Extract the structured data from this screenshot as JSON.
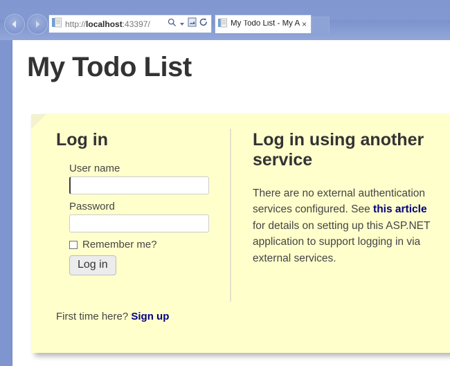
{
  "browser": {
    "back_button": "Back",
    "forward_button": "Forward",
    "address": {
      "scheme": "http://",
      "host": "localhost",
      "rest": ":43397/"
    },
    "icons": {
      "favicon": "page-icon",
      "search": "search-icon",
      "dropdown": "chevron-down-icon",
      "compatibility": "compatibility-view-icon",
      "refresh": "refresh-icon"
    },
    "tab": {
      "title": "My Todo List - My A...",
      "close_label": "×",
      "favicon": "page-icon"
    }
  },
  "page": {
    "title": "My Todo List",
    "login": {
      "heading": "Log in",
      "username_label": "User name",
      "username_value": "",
      "username_placeholder": "",
      "password_label": "Password",
      "password_value": "",
      "password_placeholder": "",
      "remember_label": "Remember me?",
      "submit_label": "Log in"
    },
    "signup": {
      "prompt": "First time here?",
      "link_label": "Sign up"
    },
    "external": {
      "heading": "Log in using another service",
      "body_before": "There are no external authentication services configured. See ",
      "link_label": "this article",
      "body_after": " for details on setting up this ASP.NET application to support logging in via external services."
    }
  },
  "colors": {
    "chrome": "#8398d1",
    "note_background": "#ffffcc",
    "note_fold": "#f2f2cf",
    "link": "#000080",
    "heading": "#333333",
    "body_text": "#444444"
  }
}
